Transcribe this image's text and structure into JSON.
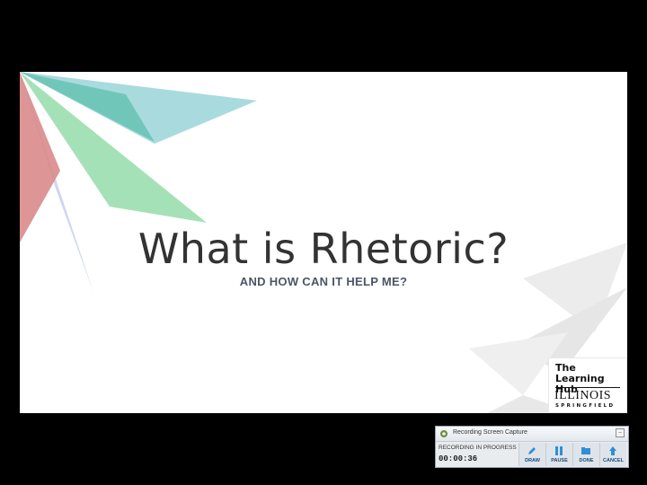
{
  "slide": {
    "title": "What is Rhetoric?",
    "subtitle": "AND HOW CAN IT HELP ME?",
    "logo": {
      "line1": "The",
      "line2": "Learning Hub",
      "line3": "ILLINOIS",
      "line4": "SPRINGFIELD"
    }
  },
  "recorder": {
    "title": "Recording Screen Capture",
    "status": "RECORDING IN PROGRESS",
    "elapsed": "00:00:36",
    "buttons": {
      "draw": "DRAW",
      "pause": "PAUSE",
      "done": "DONE",
      "cancel": "CANCEL"
    },
    "minimize_glyph": "–"
  },
  "colors": {
    "accent_blue": "#2f8fd6",
    "teal": "#7fc4c9",
    "green": "#85d19a",
    "red": "#d98a8a",
    "lavender": "#b9c7ea"
  }
}
